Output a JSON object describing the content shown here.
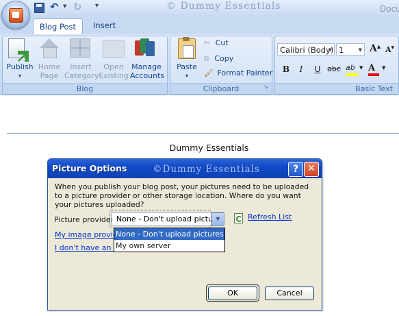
{
  "window": {
    "watermark": "© Dummy Essentials",
    "doc_title": "Docu"
  },
  "tabs": [
    "Blog Post",
    "Insert"
  ],
  "ribbon": {
    "blog_group": {
      "label": "Blog",
      "buttons": [
        {
          "line1": "Publish",
          "line2": "▾"
        },
        {
          "line1": "Home",
          "line2": "Page"
        },
        {
          "line1": "Insert",
          "line2": "Category"
        },
        {
          "line1": "Open",
          "line2": "Existing"
        },
        {
          "line1": "Manage",
          "line2": "Accounts"
        }
      ]
    },
    "clipboard_group": {
      "label": "Clipboard",
      "paste": "Paste",
      "paste_dd": "▾",
      "cut": "Cut",
      "copy": "Copy",
      "format_painter": "Format Painter",
      "launcher": "↘"
    },
    "basic_text_group": {
      "label": "Basic Text",
      "font_name": "Calibri (Body)",
      "font_size": "1",
      "grow": "A",
      "shrink": "A",
      "bold": "B",
      "italic": "I",
      "underline": "U",
      "strike": "abc",
      "highlight": "ab",
      "font_color": "A",
      "highlight_color": "#ffff00",
      "font_color_value": "#e01010"
    }
  },
  "document": {
    "text": "Dummy Essentials"
  },
  "dialog": {
    "title": "Picture Options",
    "watermark": "©Dummy Essentials",
    "help": "?",
    "close": "✕",
    "message": "When you publish your blog post, your pictures need to be uploaded to a picture provider or other storage location. Where do you want your pictures uploaded?",
    "provider_label": "Picture provider",
    "provider_value": "None - Don't upload pictures",
    "refresh_link": "Refresh List",
    "link1": "My image provider",
    "link2": "I don't have an im",
    "dropdown_options": [
      "None - Don't upload pictures",
      "My own server"
    ],
    "ok": "OK",
    "cancel": "Cancel"
  }
}
